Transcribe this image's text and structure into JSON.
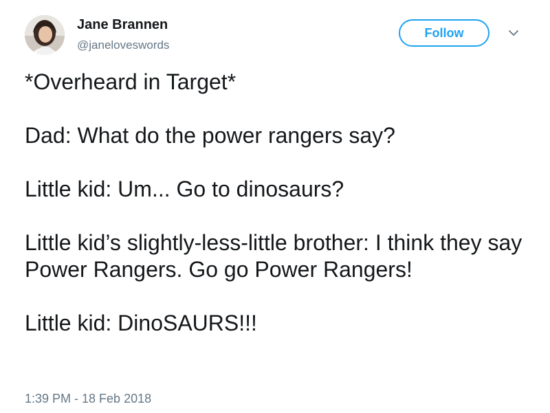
{
  "author": {
    "display_name": "Jane Brannen",
    "handle": "@janeloveswords"
  },
  "follow_label": "Follow",
  "caret_icon": "chevron-down-icon",
  "tweet_lines": [
    "*Overheard in Target*",
    "Dad: What do the power rangers say?",
    "Little kid: Um... Go to dinosaurs?",
    "Little kid’s slightly-less-little brother: I think they say Power Rangers. Go go Power Rangers!",
    "Little kid: DinoSAURS!!!"
  ],
  "timestamp": "1:39 PM - 18 Feb 2018",
  "colors": {
    "accent": "#1da1f2",
    "text": "#14171a",
    "secondary_text": "#657786"
  }
}
